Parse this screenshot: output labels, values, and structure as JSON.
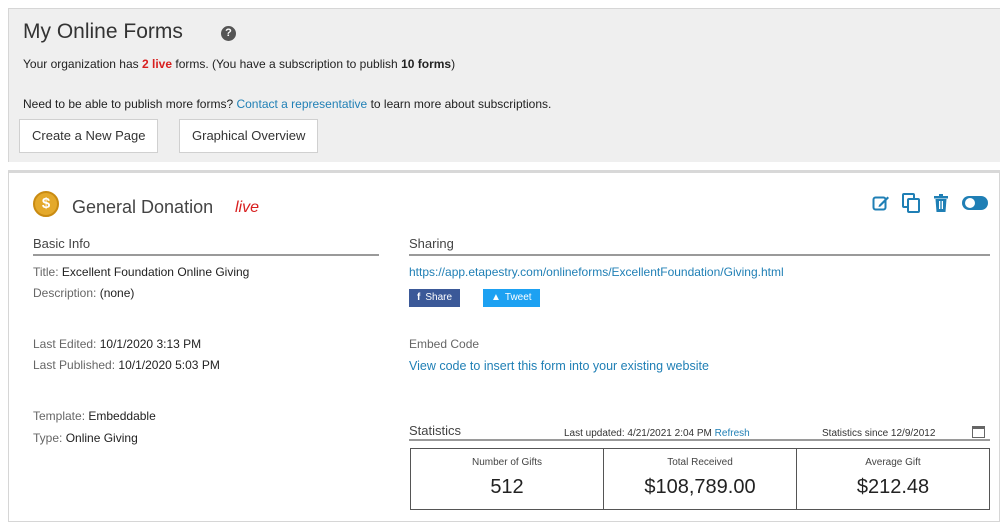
{
  "header": {
    "title": "My Online Forms",
    "help_icon": "?",
    "line1_prefix": "Your organization has",
    "live_count": "2 live",
    "line1_mid": "forms. (You have a subscription to publish",
    "subscription_count": "10 forms",
    "line1_suffix": ")",
    "line2_prefix": "Need to be able to publish more forms?",
    "contact_link": "Contact a representative",
    "line2_suffix": "to learn more about subscriptions."
  },
  "buttons": {
    "create": "Create a New Page",
    "overview": "Graphical Overview"
  },
  "form": {
    "coin_symbol": "$",
    "name": "General Donation",
    "status": "live",
    "basic_info": {
      "heading": "Basic Info",
      "title_label": "Title:",
      "title_value": "Excellent Foundation Online Giving",
      "description_label": "Description:",
      "description_value": "(none)",
      "last_edited_label": "Last Edited:",
      "last_edited_value": "10/1/2020 3:13 PM",
      "last_published_label": "Last Published:",
      "last_published_value": "10/1/2020 5:03 PM",
      "template_label": "Template:",
      "template_value": "Embeddable",
      "type_label": "Type:",
      "type_value": "Online Giving"
    },
    "sharing": {
      "heading": "Sharing",
      "url": "https://app.etapestry.com/onlineforms/ExcellentFoundation/Giving.html",
      "facebook": "Share",
      "twitter": "Tweet",
      "embed_label": "Embed Code",
      "embed_link": "View code to insert this form into your existing website"
    },
    "statistics": {
      "heading": "Statistics",
      "last_updated": "Last updated: 4/21/2021 2:04 PM",
      "refresh": "Refresh",
      "since": "Statistics since 12/9/2012",
      "cells": [
        {
          "label": "Number of Gifts",
          "value": "512"
        },
        {
          "label": "Total Received",
          "value": "$108,789.00"
        },
        {
          "label": "Average Gift",
          "value": "$212.48"
        }
      ]
    }
  },
  "icons": [
    "help-icon",
    "coin-icon",
    "edit-icon",
    "copy-icon",
    "trash-icon",
    "toggle-icon",
    "facebook-icon",
    "twitter-icon",
    "calendar-icon"
  ],
  "colors": {
    "accent": "#1f7fb5",
    "live": "#d81f1f",
    "coin": "#e4a92b"
  }
}
